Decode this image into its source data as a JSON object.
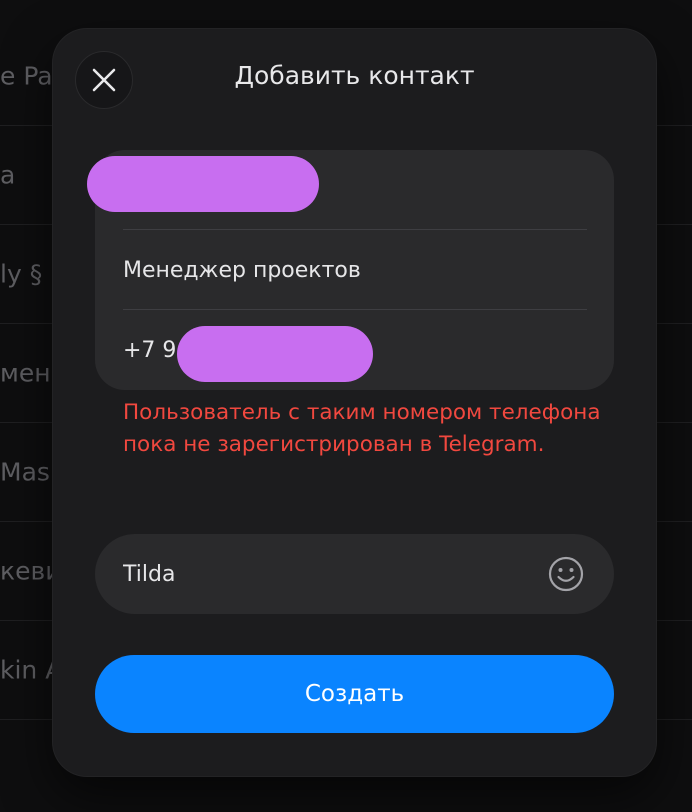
{
  "background": {
    "rows": [
      {
        "partial_label": "e Pa"
      },
      {
        "partial_label": "a"
      },
      {
        "partial_label": "ly §"
      },
      {
        "partial_label": "менк"
      },
      {
        "partial_label": "Mas"
      },
      {
        "partial_label": "кеви"
      },
      {
        "partial_label": "kin A"
      }
    ]
  },
  "modal": {
    "title": "Добавить контакт",
    "close_icon": "close-icon",
    "fields": {
      "first_name": {
        "value": "",
        "redacted": true
      },
      "last_name": {
        "value": "Менеджер проектов"
      },
      "phone": {
        "prefix": "+7 9",
        "redacted": true
      }
    },
    "error": "Пользователь с таким номером телефона пока не зарегистрирован в Telegram.",
    "name_input": {
      "value": "Tilda",
      "emoji_icon": "smiley-icon"
    },
    "create_label": "Создать"
  },
  "colors": {
    "accent": "#0a84ff",
    "error": "#f1483f",
    "redaction": "#c86ef0",
    "modal_bg": "#1c1c1e"
  }
}
